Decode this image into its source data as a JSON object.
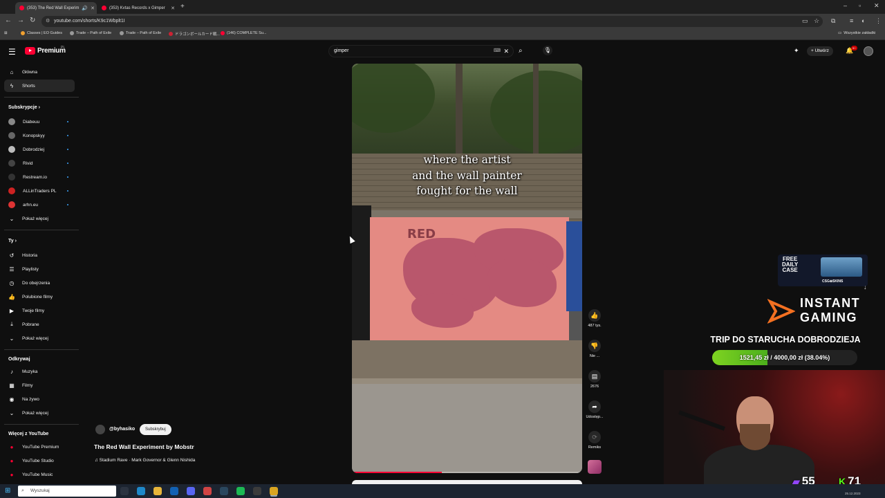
{
  "browser": {
    "tabs": [
      {
        "title": "(353) The Red Wall Experim",
        "active": true
      },
      {
        "title": "(353) Kvtas Records x Gimper",
        "active": false
      }
    ],
    "url": "youtube.com/shorts/K9c1Wbplt1I",
    "bookmarks": [
      {
        "label": "Classes | EO Guides",
        "color": "#f0a030"
      },
      {
        "label": "Trade – Path of Exile",
        "color": "#999999"
      },
      {
        "label": "Trade – Path of Exile",
        "color": "#999999"
      },
      {
        "label": "ドラゴンボールカード戦...",
        "color": "#cc2233"
      },
      {
        "label": "(146) COMPLETE Su...",
        "color": "#ff0033"
      }
    ],
    "bookmarks_all": "Wszystkie zakładki"
  },
  "youtube": {
    "logo_text": "Premium",
    "logo_region": "PL",
    "search_value": "gimper",
    "create_label": "Utwórz",
    "notifications_badge": "9+"
  },
  "sidebar": {
    "top": [
      {
        "label": "Główna",
        "icon": "home-icon",
        "glyph": "⌂"
      },
      {
        "label": "Shorts",
        "icon": "shorts-icon",
        "glyph": "ϟ",
        "active": true
      }
    ],
    "subscriptions_title": "Subskrypcje",
    "subscriptions": [
      {
        "label": "Diabeuu",
        "color": "#888888"
      },
      {
        "label": "Konopskyy",
        "color": "#666666"
      },
      {
        "label": "Dobrodziej",
        "color": "#bbbbbb"
      },
      {
        "label": "Rivid",
        "color": "#444444"
      },
      {
        "label": "Restream.io",
        "color": "#333333"
      },
      {
        "label": "ALLinTraders PL",
        "color": "#cc2222"
      },
      {
        "label": "arhn.eu",
        "color": "#dd3333"
      }
    ],
    "show_more": "Pokaż więcej",
    "you_title": "Ty",
    "you": [
      {
        "label": "Historia",
        "icon": "history-icon",
        "glyph": "↺"
      },
      {
        "label": "Playlisty",
        "icon": "playlists-icon",
        "glyph": "☰"
      },
      {
        "label": "Do obejrzenia",
        "icon": "watch-later-icon",
        "glyph": "◷"
      },
      {
        "label": "Polubione filmy",
        "icon": "liked-icon",
        "glyph": "👍"
      },
      {
        "label": "Twoje filmy",
        "icon": "your-videos-icon",
        "glyph": "▶"
      },
      {
        "label": "Pobrane",
        "icon": "download-icon",
        "glyph": "⤓"
      }
    ],
    "explore_title": "Odkrywaj",
    "explore": [
      {
        "label": "Muzyka",
        "icon": "music-icon",
        "glyph": "♪"
      },
      {
        "label": "Filmy",
        "icon": "movies-icon",
        "glyph": "▦"
      },
      {
        "label": "Na żywo",
        "icon": "live-icon",
        "glyph": "◉"
      }
    ],
    "more_title": "Więcej z YouTube",
    "more": [
      {
        "label": "YouTube Premium"
      },
      {
        "label": "YouTube Studio"
      },
      {
        "label": "YouTube Music"
      }
    ]
  },
  "video": {
    "caption": [
      "where the artist",
      "and the wall painter",
      "fought for the wall"
    ],
    "wall_text": "RED",
    "progress": 0.39,
    "channel": "@byhasiko",
    "subscribe_label": "Subskrybuj",
    "title": "The Red Wall Experiment by Mobstr",
    "music": "♫ Stadium Rave · Mark Governor & Glenn Nishida"
  },
  "actions": {
    "like_count": "487 tys.",
    "dislike_label": "Nie ...",
    "comments_count": "2676",
    "share_label": "Udostęp...",
    "remix_label": "Remiks"
  },
  "overlay": {
    "csgo_free": [
      "FREE",
      "DAILY",
      "CASE"
    ],
    "csgo_brand": "CSG⊕SKINS",
    "instant_gaming": [
      "INSTANT",
      "GAMING"
    ],
    "goal_title": "TRIP DO STARUCHA DOBRODZIEJA",
    "goal_text": "1521,45 zł / 4000,00 zł (38.04%)",
    "goal_fraction": 0.3804,
    "twitch_count": "55",
    "kick_count": "71"
  },
  "taskbar": {
    "search_placeholder": "Wyszukaj",
    "clock": "25.12.2023",
    "apps": [
      {
        "name": "task-view",
        "color": "#2b3340"
      },
      {
        "name": "edge",
        "color": "#1e88c8"
      },
      {
        "name": "explorer",
        "color": "#e7b53a"
      },
      {
        "name": "outlook",
        "color": "#1261b3"
      },
      {
        "name": "discord",
        "color": "#5865f2"
      },
      {
        "name": "calendar",
        "color": "#d14444"
      },
      {
        "name": "steam",
        "color": "#2a475e"
      },
      {
        "name": "spotify",
        "color": "#1db954"
      },
      {
        "name": "obs",
        "color": "#3b3b3b"
      },
      {
        "name": "chrome",
        "color": "#d9a521"
      }
    ]
  }
}
